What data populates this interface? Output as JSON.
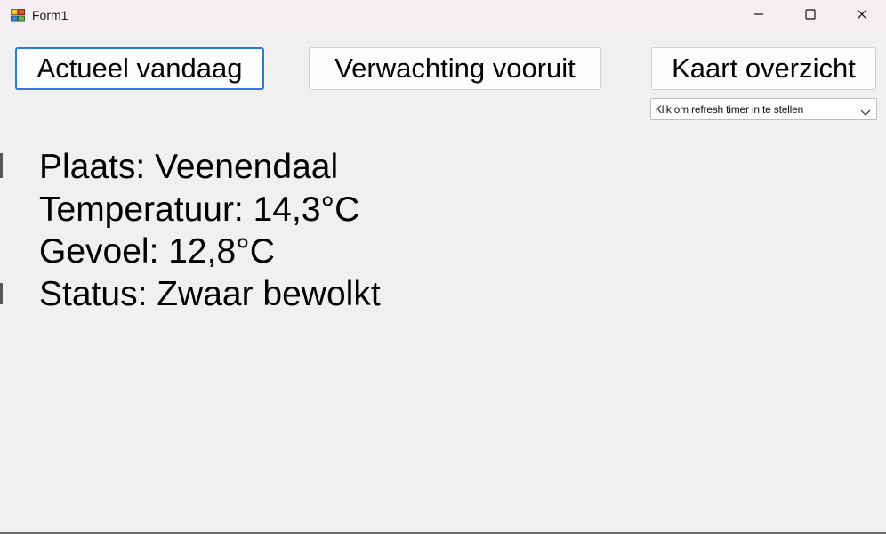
{
  "window": {
    "title": "Form1",
    "icon": "form-app-icon",
    "controls": [
      "minimize-icon",
      "maximize-icon",
      "close-icon"
    ]
  },
  "toolbar": {
    "actueel_label": "Actueel vandaag",
    "verwachting_label": "Verwachting vooruit",
    "kaart_label": "Kaart overzicht"
  },
  "refresh_combo": {
    "selected": "Klik om refresh timer in te stellen",
    "icon": "chevron-down-icon"
  },
  "weather": {
    "plaats": "Plaats: Veenendaal",
    "temperatuur": "Temperatuur: 14,3°C",
    "gevoel": "Gevoel: 12,8°C",
    "status": "Status: Zwaar bewolkt"
  },
  "colors": {
    "focus_border": "#2d7ad6",
    "background": "#f0f0f0"
  }
}
